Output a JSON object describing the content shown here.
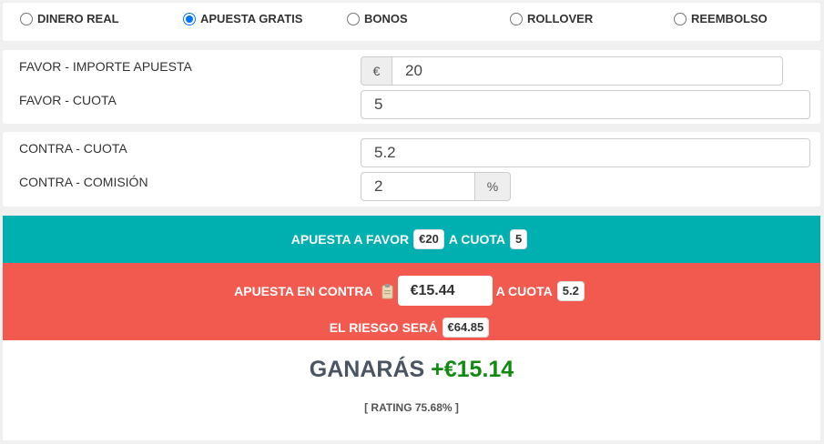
{
  "radio_options": [
    {
      "label": "DINERO REAL",
      "checked": false
    },
    {
      "label": "APUESTA GRATIS",
      "checked": true
    },
    {
      "label": "BONOS",
      "checked": false
    },
    {
      "label": "ROLLOVER",
      "checked": false
    },
    {
      "label": "REEMBOLSO",
      "checked": false
    }
  ],
  "favor": {
    "stake_label": "FAVOR - IMPORTE APUESTA",
    "stake_currency": "€",
    "stake_value": "20",
    "odds_label": "FAVOR - CUOTA",
    "odds_value": "5"
  },
  "contra": {
    "odds_label": "CONTRA - CUOTA",
    "odds_value": "5.2",
    "commission_label": "CONTRA - COMISIÓN",
    "commission_value": "2",
    "commission_unit": "%"
  },
  "favor_bar": {
    "text1": "APUESTA A FAVOR",
    "amount": "€20",
    "text2": "A CUOTA",
    "odds": "5"
  },
  "contra_bar": {
    "text1": "APUESTA EN CONTRA",
    "amount": "€15.44",
    "text2": "A CUOTA",
    "odds": "5.2",
    "risk_text": "EL RIESGO SERÁ",
    "risk_amount": "€64.85"
  },
  "result": {
    "label": "GANARÁS",
    "value": "+€15.14",
    "rating": "[ RATING 75.68% ]"
  },
  "colors": {
    "teal": "#00afaf",
    "red": "#f25a4f",
    "profit_green": "#128a12",
    "radio_blue": "#0075ff"
  }
}
